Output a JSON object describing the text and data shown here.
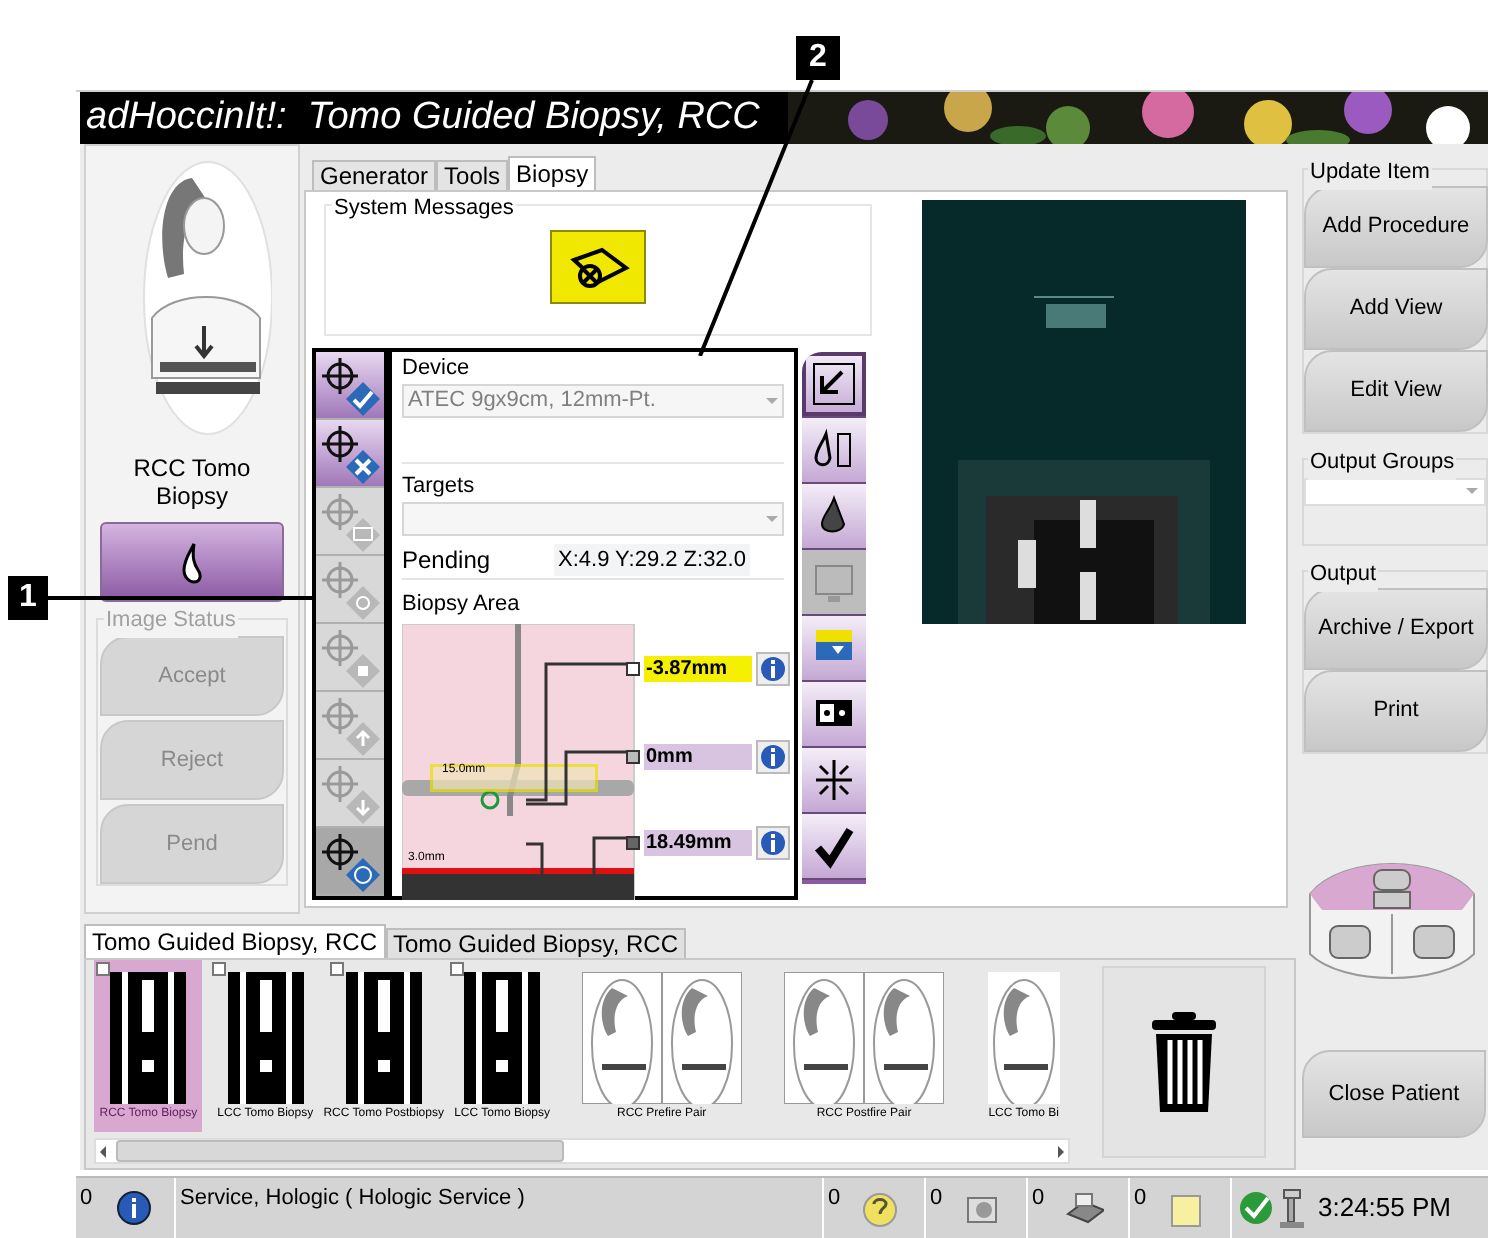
{
  "callouts": [
    {
      "label": "1"
    },
    {
      "label": "2"
    }
  ],
  "title": {
    "text": "adHoccinIt!:  Tomo Guided Biopsy, RCC"
  },
  "view_label": "RCC Tomo Biopsy",
  "image_status": {
    "title": "Image Status",
    "buttons": [
      {
        "label": "Accept",
        "disabled": true
      },
      {
        "label": "Reject",
        "disabled": true
      },
      {
        "label": "Pend",
        "disabled": true
      }
    ]
  },
  "tabs": [
    {
      "label": "Generator",
      "selected": false
    },
    {
      "label": "Tools",
      "selected": false
    },
    {
      "label": "Biopsy",
      "selected": true
    }
  ],
  "system_messages": {
    "title": "System Messages"
  },
  "target_tools": [
    {
      "kind": "check",
      "disabled": false
    },
    {
      "kind": "cross",
      "disabled": false
    },
    {
      "kind": "mail",
      "disabled": true
    },
    {
      "kind": "camera",
      "disabled": true
    },
    {
      "kind": "stop",
      "disabled": true
    },
    {
      "kind": "up",
      "disabled": true
    },
    {
      "kind": "down",
      "disabled": true
    },
    {
      "kind": "target",
      "disabled": false
    }
  ],
  "device": {
    "label": "Device",
    "value": "ATEC 9gx9cm, 12mm-Pt."
  },
  "targets": {
    "label": "Targets"
  },
  "pending": {
    "label": "Pending",
    "value": "X:4.9 Y:29.2 Z:32.0"
  },
  "biopsy_area": {
    "title": "Biopsy Area",
    "window_label": "15.0mm",
    "base_label": "3.0mm",
    "readings": [
      {
        "value": "-3.87mm",
        "highlighted": true
      },
      {
        "value": "0mm",
        "highlighted": false
      },
      {
        "value": "18.49mm",
        "highlighted": false
      }
    ]
  },
  "side_tools": [
    {
      "kind": "swap",
      "disabled": false,
      "selected": true
    },
    {
      "kind": "ruler",
      "disabled": false,
      "selected": false
    },
    {
      "kind": "drop",
      "disabled": false,
      "selected": false
    },
    {
      "kind": "monitor",
      "disabled": true,
      "selected": false
    },
    {
      "kind": "transfer",
      "disabled": false,
      "selected": false
    },
    {
      "kind": "dots",
      "disabled": false,
      "selected": false
    },
    {
      "kind": "burst",
      "disabled": false,
      "selected": false
    },
    {
      "kind": "check",
      "disabled": false,
      "selected": false
    }
  ],
  "update_item": {
    "title": "Update Item",
    "buttons": [
      "Add Procedure",
      "Add View",
      "Edit View"
    ]
  },
  "output_groups": {
    "title": "Output Groups"
  },
  "output": {
    "title": "Output",
    "buttons": [
      "Archive / Export",
      "Print"
    ]
  },
  "close_button": "Close Patient",
  "procedure_tabs": [
    {
      "label": "Tomo Guided Biopsy, RCC",
      "selected": true
    },
    {
      "label": "Tomo Guided Biopsy, RCC",
      "selected": false
    }
  ],
  "thumbnails": [
    {
      "label": "RCC Tomo Biopsy",
      "kind": "xray",
      "selected": true
    },
    {
      "label": "LCC Tomo Biopsy",
      "kind": "xray",
      "selected": false
    },
    {
      "label": "RCC Tomo Postbiopsy",
      "kind": "xray",
      "selected": false
    },
    {
      "label": "LCC Tomo Biopsy",
      "kind": "xray",
      "selected": false
    },
    {
      "label": "RCC Prefire Pair",
      "kind": "pair",
      "selected": false
    },
    {
      "label": "RCC Postfire Pair",
      "kind": "pair",
      "selected": false
    },
    {
      "label": "LCC Tomo Bi",
      "kind": "single",
      "selected": false
    }
  ],
  "status_bar": {
    "messages": "0",
    "user": "Service, Hologic ( Hologic Service )",
    "counts": [
      "0",
      "0",
      "0",
      "0"
    ],
    "time": "3:24:55 PM"
  }
}
